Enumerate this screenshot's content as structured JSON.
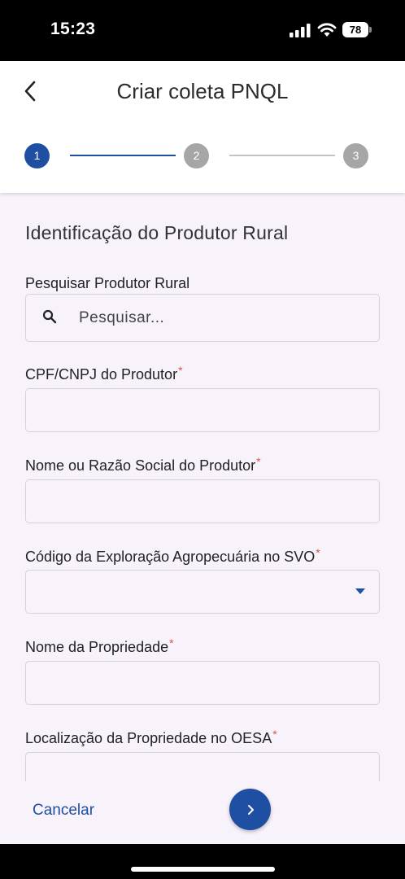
{
  "status_bar": {
    "time": "15:23",
    "battery": "78"
  },
  "header": {
    "title": "Criar coleta PNQL"
  },
  "stepper": {
    "steps": [
      "1",
      "2",
      "3"
    ],
    "active_step": 1
  },
  "section": {
    "title": "Identificação do Produtor Rural"
  },
  "fields": {
    "search": {
      "label": "Pesquisar Produtor Rural",
      "placeholder": "Pesquisar..."
    },
    "cpf_cnpj": {
      "label": "CPF/CNPJ do Produtor",
      "required": "*",
      "value": ""
    },
    "nome_razao": {
      "label": "Nome ou Razão Social do Produtor",
      "required": "*",
      "value": ""
    },
    "codigo_exploracao": {
      "label": "Código da Exploração Agropecuária no SVO",
      "required": "*",
      "value": ""
    },
    "nome_propriedade": {
      "label": "Nome da Propriedade",
      "required": "*",
      "value": ""
    },
    "localizacao": {
      "label": "Localização da Propriedade no OESA",
      "required": "*",
      "value": ""
    }
  },
  "footer": {
    "cancel_label": "Cancelar"
  },
  "colors": {
    "primary": "#1f4fa3",
    "inactive_step": "#a6a6a6",
    "required": "#d9534f",
    "background": "#f8f2fa"
  },
  "icons": {
    "back": "chevron-left-icon",
    "search": "search-icon",
    "dropdown": "caret-down-icon",
    "next": "chevron-right-icon"
  }
}
